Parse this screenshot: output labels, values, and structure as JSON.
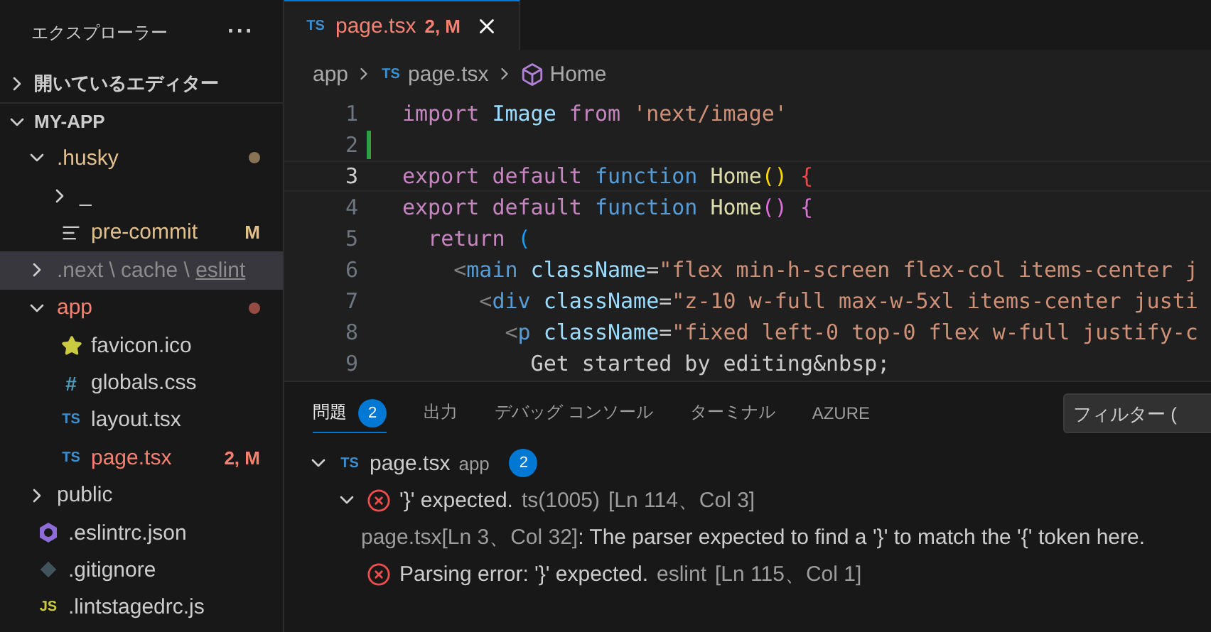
{
  "sidebar": {
    "title": "エクスプローラー",
    "more": "···",
    "sections": [
      {
        "label": "開いているエディター",
        "expanded": false
      },
      {
        "label": "MY-APP",
        "expanded": true,
        "items": [
          {
            "kind": "folder",
            "label": ".husky",
            "expanded": true,
            "color": "#e2c08d",
            "dot": true,
            "children": [
              {
                "kind": "folder",
                "label": "_",
                "expanded": false
              },
              {
                "kind": "text-file",
                "label": "pre-commit",
                "color": "#e2c08d",
                "badge": "M"
              }
            ]
          },
          {
            "kind": "folder",
            "segments": [
              ".next",
              "cache",
              "eslint"
            ],
            "separator": "\\",
            "expanded": false,
            "color": "#8c8c8c",
            "selected": true
          },
          {
            "kind": "folder",
            "label": "app",
            "expanded": true,
            "color": "#f88070",
            "dot": true,
            "children": [
              {
                "kind": "image-file",
                "label": "favicon.ico"
              },
              {
                "kind": "css-file",
                "label": "globals.css",
                "glyph": "#"
              },
              {
                "kind": "ts-file",
                "label": "layout.tsx",
                "glyph": "TS"
              },
              {
                "kind": "ts-file",
                "label": "page.tsx",
                "glyph": "TS",
                "color": "#f88070",
                "badge": "2, M"
              }
            ]
          },
          {
            "kind": "folder",
            "label": "public",
            "expanded": false
          },
          {
            "kind": "config-file",
            "label": ".eslintrc.json"
          },
          {
            "kind": "git-file",
            "label": ".gitignore"
          },
          {
            "kind": "js-file",
            "label": ".lintstagedrc.js",
            "glyph": "JS"
          }
        ]
      }
    ]
  },
  "tabs": [
    {
      "glyph": "TS",
      "label": "page.tsx",
      "badge": "2, M",
      "selected": true
    }
  ],
  "breadcrumb": [
    {
      "kind": "folder",
      "label": "app"
    },
    {
      "kind": "file",
      "glyph": "TS",
      "label": "page.tsx"
    },
    {
      "kind": "symbol",
      "label": "Home"
    }
  ],
  "code": [
    {
      "number": "1",
      "current": false,
      "tokens": [
        {
          "kind": "keyword",
          "text": "import"
        },
        {
          "kind": "var",
          "text": " Image"
        },
        {
          "kind": "keyword",
          "text": " from"
        },
        {
          "kind": "string",
          "text": " 'next/image'"
        }
      ]
    },
    {
      "number": "2",
      "current": false,
      "added": true
    },
    {
      "number": "3",
      "current": true,
      "tokens": [
        {
          "kind": "keyword",
          "text": "export default"
        },
        {
          "kind": "storage",
          "text": " function"
        },
        {
          "kind": "func",
          "text": " Home"
        },
        {
          "kind": "b1",
          "text": "()"
        },
        {
          "kind": "err",
          "text": " {"
        }
      ]
    },
    {
      "number": "4",
      "current": false,
      "tokens": [
        {
          "kind": "keyword",
          "text": "export default"
        },
        {
          "kind": "storage",
          "text": " function"
        },
        {
          "kind": "func",
          "text": " Home"
        },
        {
          "kind": "b2",
          "text": "()"
        },
        {
          "kind": "b2",
          "text": " {"
        }
      ]
    },
    {
      "number": "5",
      "current": false,
      "tokens": [
        {
          "kind": "keyword",
          "text": "  return"
        },
        {
          "kind": "b3",
          "text": " ("
        }
      ]
    },
    {
      "number": "6",
      "current": false,
      "tokens": [
        {
          "kind": "punct",
          "text": "    <"
        },
        {
          "kind": "tag",
          "text": "main"
        },
        {
          "kind": "var",
          "text": " className"
        },
        {
          "kind": "plain",
          "text": "="
        },
        {
          "kind": "string",
          "text": "\"flex min-h-screen flex-col items-center j"
        }
      ]
    },
    {
      "number": "7",
      "current": false,
      "tokens": [
        {
          "kind": "punct",
          "text": "      <"
        },
        {
          "kind": "tag",
          "text": "div"
        },
        {
          "kind": "var",
          "text": " className"
        },
        {
          "kind": "plain",
          "text": "="
        },
        {
          "kind": "string",
          "text": "\"z-10 w-full max-w-5xl items-center justi"
        }
      ]
    },
    {
      "number": "8",
      "current": false,
      "tokens": [
        {
          "kind": "punct",
          "text": "        <"
        },
        {
          "kind": "tag",
          "text": "p"
        },
        {
          "kind": "var",
          "text": " className"
        },
        {
          "kind": "plain",
          "text": "="
        },
        {
          "kind": "string",
          "text": "\"fixed left-0 top-0 flex w-full justify-c"
        }
      ]
    },
    {
      "number": "9",
      "current": false,
      "tokens": [
        {
          "kind": "plain",
          "text": "          Get started by editing&nbsp;"
        }
      ]
    }
  ],
  "panel": {
    "tabs": [
      {
        "label": "問題",
        "count": "2",
        "selected": true
      },
      {
        "label": "出力",
        "selected": false
      },
      {
        "label": "デバッグ コンソール",
        "selected": false
      },
      {
        "label": "ターミナル",
        "selected": false
      },
      {
        "label": "AZURE",
        "selected": false
      }
    ],
    "filter": {
      "placeholder": "フィルター ("
    },
    "problems": [
      {
        "kind": "file",
        "glyph": "TS",
        "label": "page.tsx",
        "folder": "app",
        "count": "2",
        "expanded": true,
        "children": [
          {
            "kind": "error",
            "message": "'}' expected.",
            "source": "ts(1005)",
            "location": "[Ln 114、Col 3]",
            "expanded": true,
            "children": [
              {
                "kind": "related",
                "location": "page.tsx[Ln 3、Col 32]",
                "message": ": The parser expected to find a '}' to match the '{' token here."
              }
            ]
          },
          {
            "kind": "error",
            "message": "Parsing error: '}' expected.",
            "source": "eslint",
            "location": "[Ln 115、Col 1]"
          }
        ]
      }
    ]
  }
}
